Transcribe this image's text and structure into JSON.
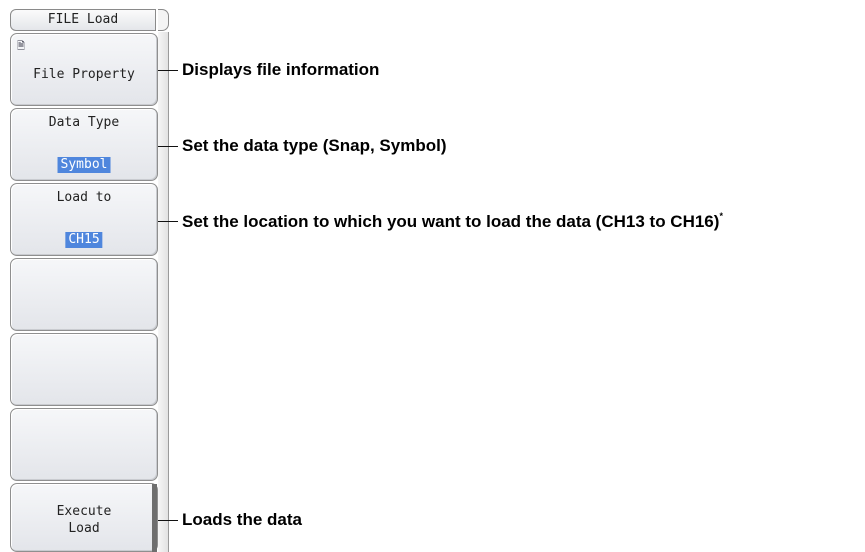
{
  "menu": {
    "title": "FILE Load",
    "softkeys": [
      {
        "icon": "file-info-icon",
        "label": "File Property"
      },
      {
        "label": "Data Type",
        "value": "Symbol"
      },
      {
        "label": "Load to",
        "value": "CH15"
      },
      {
        "label": ""
      },
      {
        "label": ""
      },
      {
        "label": ""
      },
      {
        "line1": "Execute",
        "line2": "Load"
      }
    ]
  },
  "callouts": {
    "file_property": "Displays file information",
    "data_type": "Set the data type (Snap, Symbol)",
    "load_to": "Set the location to which you want to load the data (CH13 to CH16)",
    "load_to_mark": "*",
    "execute": "Loads the data"
  }
}
